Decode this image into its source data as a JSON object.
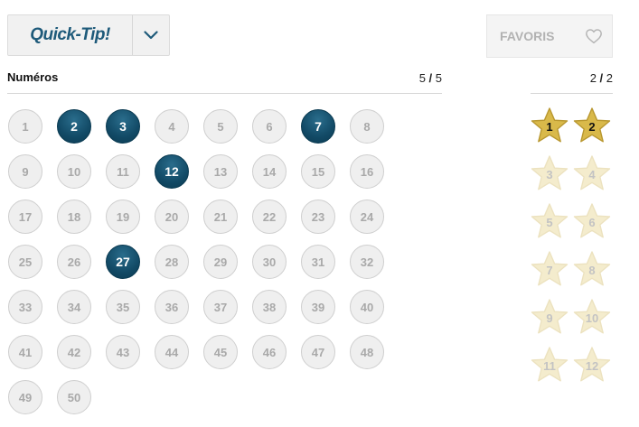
{
  "quicktip": {
    "label": "Quick-Tip!"
  },
  "favoris": {
    "label": "FAVORIS"
  },
  "numbers_section": {
    "label": "Numéros",
    "count_selected": "5",
    "count_sep": " / ",
    "count_total": "5"
  },
  "stars_section": {
    "count_selected": "2",
    "count_sep": " / ",
    "count_total": "2"
  },
  "numbers": [
    {
      "n": "1",
      "selected": false
    },
    {
      "n": "2",
      "selected": true
    },
    {
      "n": "3",
      "selected": true
    },
    {
      "n": "4",
      "selected": false
    },
    {
      "n": "5",
      "selected": false
    },
    {
      "n": "6",
      "selected": false
    },
    {
      "n": "7",
      "selected": true
    },
    {
      "n": "8",
      "selected": false
    },
    {
      "n": "9",
      "selected": false
    },
    {
      "n": "10",
      "selected": false
    },
    {
      "n": "11",
      "selected": false
    },
    {
      "n": "12",
      "selected": true
    },
    {
      "n": "13",
      "selected": false
    },
    {
      "n": "14",
      "selected": false
    },
    {
      "n": "15",
      "selected": false
    },
    {
      "n": "16",
      "selected": false
    },
    {
      "n": "17",
      "selected": false
    },
    {
      "n": "18",
      "selected": false
    },
    {
      "n": "19",
      "selected": false
    },
    {
      "n": "20",
      "selected": false
    },
    {
      "n": "21",
      "selected": false
    },
    {
      "n": "22",
      "selected": false
    },
    {
      "n": "23",
      "selected": false
    },
    {
      "n": "24",
      "selected": false
    },
    {
      "n": "25",
      "selected": false
    },
    {
      "n": "26",
      "selected": false
    },
    {
      "n": "27",
      "selected": true
    },
    {
      "n": "28",
      "selected": false
    },
    {
      "n": "29",
      "selected": false
    },
    {
      "n": "30",
      "selected": false
    },
    {
      "n": "31",
      "selected": false
    },
    {
      "n": "32",
      "selected": false
    },
    {
      "n": "33",
      "selected": false
    },
    {
      "n": "34",
      "selected": false
    },
    {
      "n": "35",
      "selected": false
    },
    {
      "n": "36",
      "selected": false
    },
    {
      "n": "37",
      "selected": false
    },
    {
      "n": "38",
      "selected": false
    },
    {
      "n": "39",
      "selected": false
    },
    {
      "n": "40",
      "selected": false
    },
    {
      "n": "41",
      "selected": false
    },
    {
      "n": "42",
      "selected": false
    },
    {
      "n": "43",
      "selected": false
    },
    {
      "n": "44",
      "selected": false
    },
    {
      "n": "45",
      "selected": false
    },
    {
      "n": "46",
      "selected": false
    },
    {
      "n": "47",
      "selected": false
    },
    {
      "n": "48",
      "selected": false
    },
    {
      "n": "49",
      "selected": false
    },
    {
      "n": "50",
      "selected": false
    }
  ],
  "stars": [
    {
      "n": "1",
      "selected": true
    },
    {
      "n": "2",
      "selected": true
    },
    {
      "n": "3",
      "selected": false
    },
    {
      "n": "4",
      "selected": false
    },
    {
      "n": "5",
      "selected": false
    },
    {
      "n": "6",
      "selected": false
    },
    {
      "n": "7",
      "selected": false
    },
    {
      "n": "8",
      "selected": false
    },
    {
      "n": "9",
      "selected": false
    },
    {
      "n": "10",
      "selected": false
    },
    {
      "n": "11",
      "selected": false
    },
    {
      "n": "12",
      "selected": false
    }
  ],
  "colors": {
    "selected_ball": "#124a66",
    "quicktip_text": "#1e5a7a",
    "star_gold": "#d9b94a",
    "star_pale": "#f4eccd"
  },
  "icons": {
    "dropdown": "chevron-down-icon",
    "favorite": "heart-icon"
  }
}
